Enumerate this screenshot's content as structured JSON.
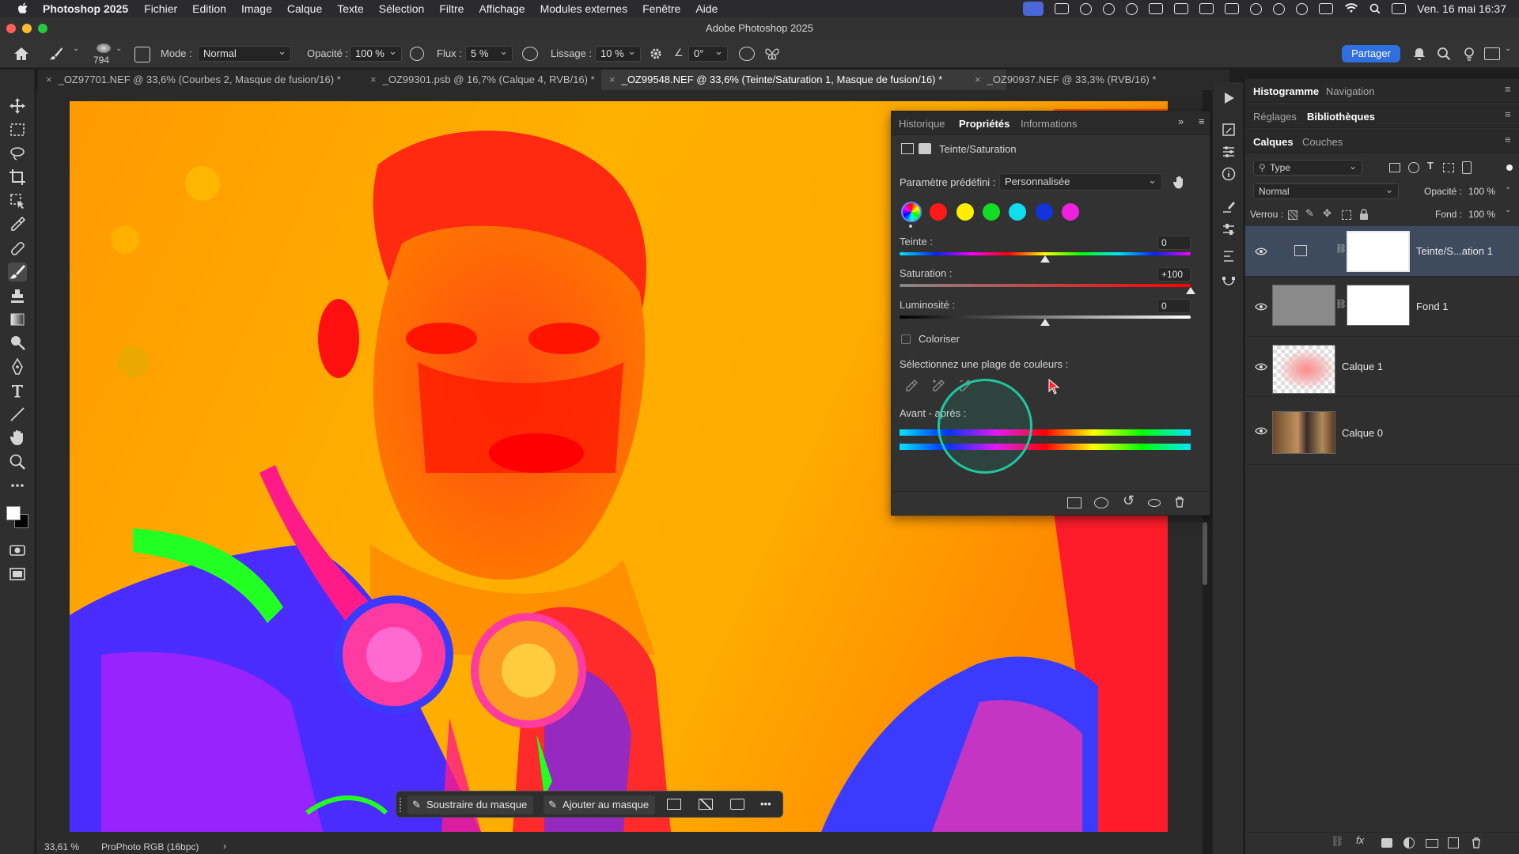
{
  "menubar": {
    "app_name": "Photoshop 2025",
    "items": [
      "Fichier",
      "Edition",
      "Image",
      "Calque",
      "Texte",
      "Sélection",
      "Filtre",
      "Affichage",
      "Modules externes",
      "Fenêtre",
      "Aide"
    ],
    "clock": "Ven. 16 mai  16:37"
  },
  "window": {
    "title": "Adobe Photoshop 2025"
  },
  "options": {
    "brush_size": "794",
    "mode_label": "Mode :",
    "mode_value": "Normal",
    "opacity_label": "Opacité :",
    "opacity_value": "100 %",
    "flow_label": "Flux :",
    "flow_value": "5 %",
    "smoothing_label": "Lissage :",
    "smoothing_value": "10 %",
    "angle_value": "0°",
    "share_label": "Partager"
  },
  "tabs": [
    "_OZ97701.NEF @ 33,6% (Courbes 2, Masque de fusion/16) *",
    "_OZ99301.psb @ 16,7% (Calque 4, RVB/16) *",
    "_OZ99548.NEF @ 33,6% (Teinte/Saturation 1, Masque de fusion/16) *",
    "_OZ90937.NEF @ 33,3% (RVB/16) *"
  ],
  "status": {
    "zoom": "33,61 %",
    "profile": "ProPhoto RGB (16bpc)",
    "arrow": "›"
  },
  "properties": {
    "tabs": [
      "Historique",
      "Propriétés",
      "Informations"
    ],
    "adjustment_name": "Teinte/Saturation",
    "preset_label": "Paramètre prédéfini :",
    "preset_value": "Personnalisée",
    "hue_label": "Teinte :",
    "hue_value": "0",
    "saturation_label": "Saturation :",
    "saturation_value": "+100",
    "lightness_label": "Luminosité :",
    "lightness_value": "0",
    "colorize_label": "Coloriser",
    "range_label": "Sélectionnez une plage de couleurs :",
    "before_after_label": "Avant - après :",
    "swatch_colors": [
      "#ff1a1a",
      "#ffee00",
      "#11dd22",
      "#11ddee",
      "#1133dd",
      "#ee22dd"
    ],
    "hue_level": 0.5,
    "saturation_level": 1.0,
    "lightness_level": 0.5
  },
  "panels": {
    "top_tabs": [
      "Histogramme",
      "Navigation"
    ],
    "mid_tabs": [
      "Réglages",
      "Bibliothèques"
    ],
    "layer_tabs": [
      "Calques",
      "Couches"
    ],
    "filter_type": "Type",
    "blend_mode": "Normal",
    "opacity_label": "Opacité :",
    "opacity_value": "100 %",
    "lock_label": "Verrou :",
    "fill_label": "Fond :",
    "fill_value": "100 %",
    "layers": [
      {
        "name": "Teinte/S...ation 1"
      },
      {
        "name": "Fond 1"
      },
      {
        "name": "Calque 1"
      },
      {
        "name": "Calque 0"
      }
    ]
  },
  "context_bar": {
    "subtract_label": "Soustraire du masque",
    "add_label": "Ajouter au masque",
    "more_label": "•••"
  }
}
